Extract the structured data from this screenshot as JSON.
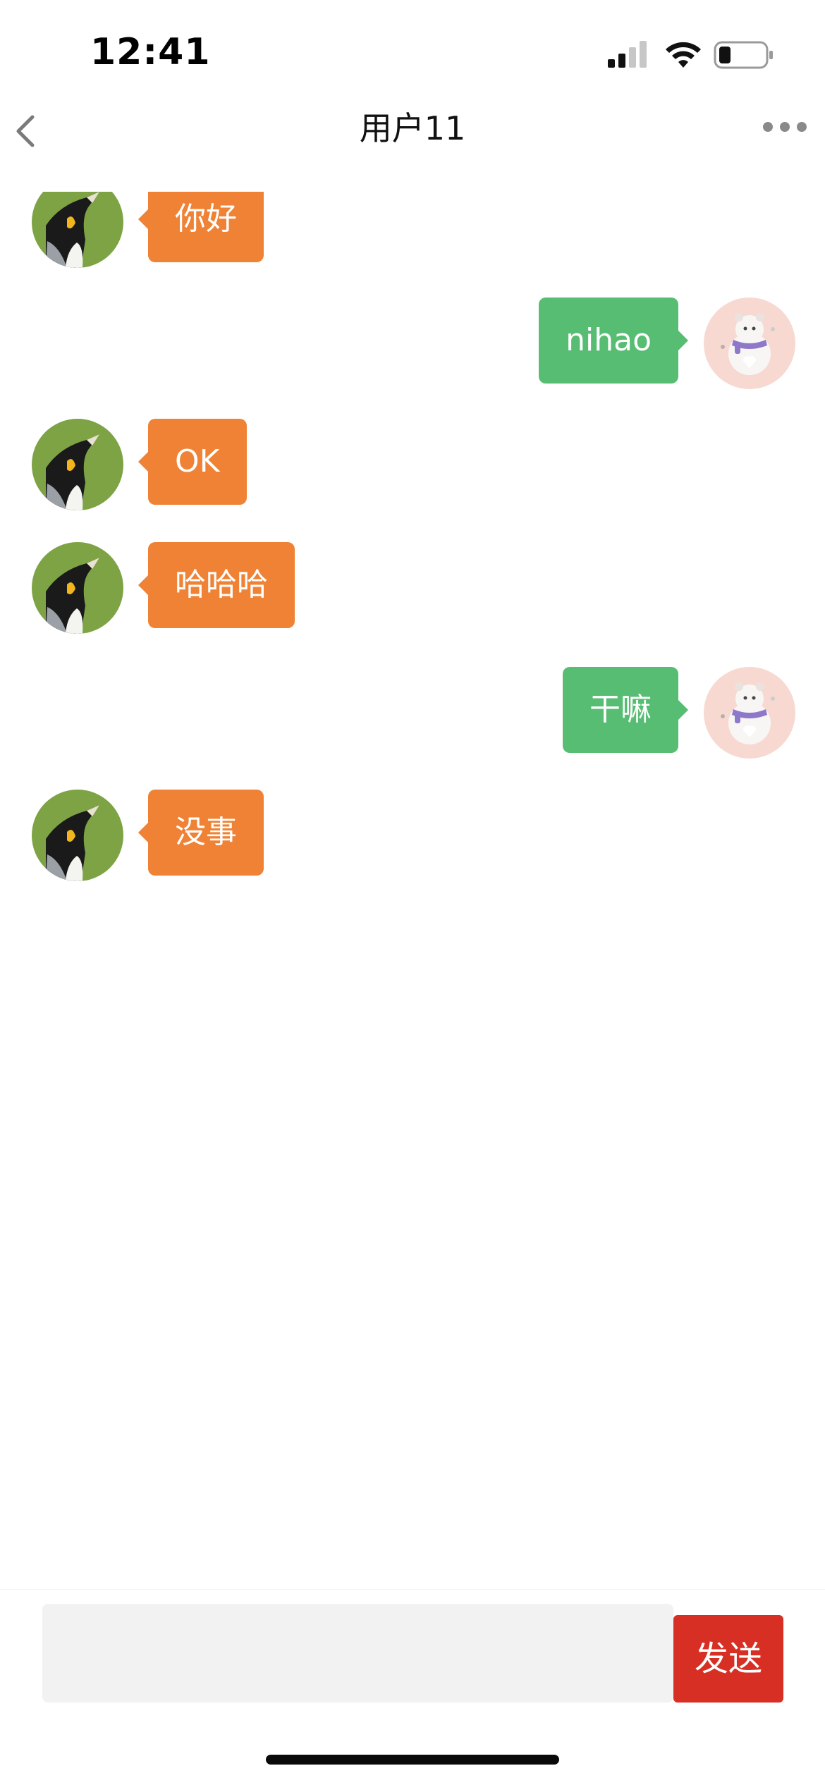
{
  "status_bar": {
    "time": "12:41",
    "signal_icon": "cellular-signal-icon",
    "wifi_icon": "wifi-icon",
    "battery_icon": "battery-icon"
  },
  "nav": {
    "title": "用户11",
    "back_icon": "chevron-left-icon",
    "more_icon": "more-dots-icon"
  },
  "messages": [
    {
      "side": "left",
      "avatar": "penguin-avatar",
      "text": "你好"
    },
    {
      "side": "right",
      "avatar": "bear-avatar",
      "text": "nihao"
    },
    {
      "side": "left",
      "avatar": "penguin-avatar",
      "text": "OK"
    },
    {
      "side": "left",
      "avatar": "penguin-avatar",
      "text": "哈哈哈"
    },
    {
      "side": "right",
      "avatar": "bear-avatar",
      "text": "干嘛"
    },
    {
      "side": "left",
      "avatar": "penguin-avatar",
      "text": "没事"
    }
  ],
  "composer": {
    "input_value": "",
    "send_label": "发送"
  },
  "colors": {
    "received_bubble": "#ef8234",
    "sent_bubble": "#57bd73",
    "send_button": "#d82f24",
    "input_background": "#f2f2f2"
  }
}
